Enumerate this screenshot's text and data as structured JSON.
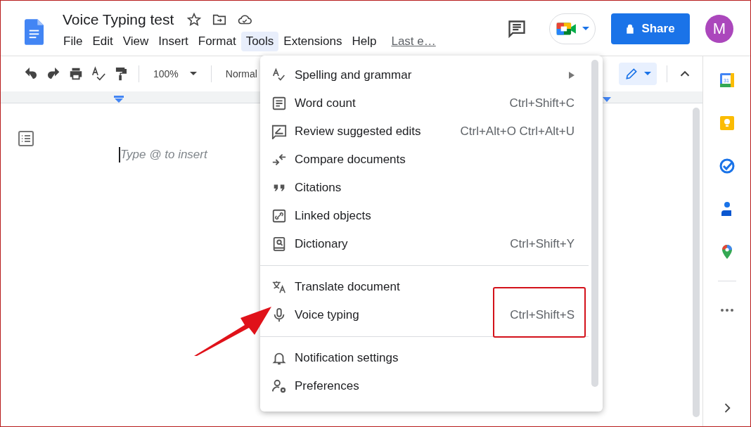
{
  "document": {
    "title": "Voice Typing test",
    "placeholder": "Type @ to insert"
  },
  "menubar": [
    {
      "label": "File",
      "selected": false
    },
    {
      "label": "Edit",
      "selected": false
    },
    {
      "label": "View",
      "selected": false
    },
    {
      "label": "Insert",
      "selected": false
    },
    {
      "label": "Format",
      "selected": false
    },
    {
      "label": "Tools",
      "selected": true
    },
    {
      "label": "Extensions",
      "selected": false
    },
    {
      "label": "Help",
      "selected": false
    }
  ],
  "last_edit_link": "Last e…",
  "share_button": "Share",
  "avatar": "M",
  "calendar_day": "31",
  "toolbar": {
    "zoom": "100%",
    "style": "Normal"
  },
  "tools_menu": {
    "groups": [
      [
        {
          "label": "Spelling and grammar",
          "submenu": true,
          "highlighted": false
        },
        {
          "label": "Word count",
          "shortcut": "Ctrl+Shift+C",
          "submenu": false,
          "highlighted": false
        },
        {
          "label": "Review suggested edits",
          "shortcut": "Ctrl+Alt+O Ctrl+Alt+U",
          "submenu": false,
          "highlighted": false
        },
        {
          "label": "Compare documents",
          "submenu": false,
          "highlighted": false
        },
        {
          "label": "Citations",
          "submenu": false,
          "highlighted": false
        },
        {
          "label": "Linked objects",
          "submenu": false,
          "highlighted": false
        },
        {
          "label": "Dictionary",
          "shortcut": "Ctrl+Shift+Y",
          "submenu": false,
          "highlighted": false
        }
      ],
      [
        {
          "label": "Translate document",
          "submenu": false,
          "highlighted": false
        },
        {
          "label": "Voice typing",
          "shortcut": "Ctrl+Shift+S",
          "submenu": false,
          "highlighted": true
        }
      ],
      [
        {
          "label": "Notification settings",
          "submenu": false,
          "highlighted": false
        },
        {
          "label": "Preferences",
          "submenu": false,
          "highlighted": false
        }
      ]
    ]
  }
}
